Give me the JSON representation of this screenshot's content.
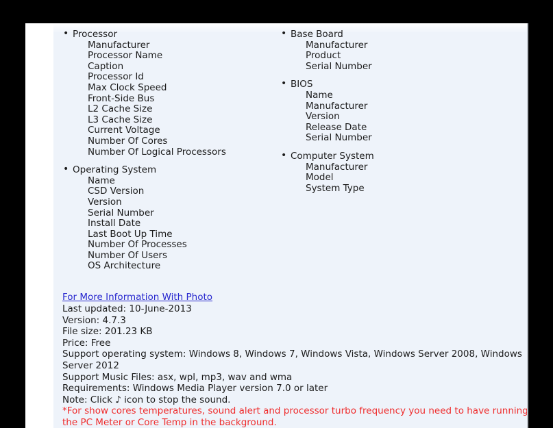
{
  "theme": {
    "backdrop": "#000000",
    "sheet_bg": "#ffffff",
    "content_bg": "#eef3fa",
    "text": "#1b1b1b",
    "link": "#2929cf",
    "warning": "#ef2c2c",
    "border": "#b9bec4"
  },
  "spec_columns": {
    "left": [
      {
        "title": "Processor",
        "fields": [
          "Manufacturer",
          "Processor Name",
          "Caption",
          "Processor Id",
          "Max Clock Speed",
          "Front-Side Bus",
          "L2 Cache Size",
          "L3 Cache Size",
          "Current Voltage",
          "Number Of Cores",
          "Number Of Logical Processors"
        ]
      },
      {
        "title": "Operating System",
        "fields": [
          "Name",
          "CSD Version",
          "Version",
          "Serial Number",
          "Install Date",
          "Last Boot Up Time",
          "Number Of Processes",
          "Number Of Users",
          "OS Architecture"
        ]
      }
    ],
    "right": [
      {
        "title": "Base Board",
        "fields": [
          "Manufacturer",
          "Product",
          "Serial Number"
        ]
      },
      {
        "title": "BIOS",
        "fields": [
          "Name",
          "Manufacturer",
          "Version",
          "Release Date",
          "Serial Number"
        ]
      },
      {
        "title": "Computer System",
        "fields": [
          "Manufacturer",
          "Model",
          "System Type"
        ]
      }
    ]
  },
  "info": {
    "more_info_link": "For More Information With Photo",
    "last_updated": "Last updated: 10-June-2013",
    "version": "Version: 4.7.3",
    "file_size": "File size: 201.23 KB",
    "price": "Price: Free",
    "support_os": "Support operating system: Windows 8, Windows 7, Windows Vista, Windows Server 2008, Windows Server 2012",
    "support_music_files": "Support Music Files: asx, wpl, mp3, wav and wma",
    "requirements": "Requirements: Windows Media Player version 7.0 or later",
    "note": "Note: Click ♪ icon to stop the sound.",
    "warning": "*For show cores temperatures, sound alert and processor turbo frequency you need to have running the PC Meter or Core Temp in the background."
  }
}
